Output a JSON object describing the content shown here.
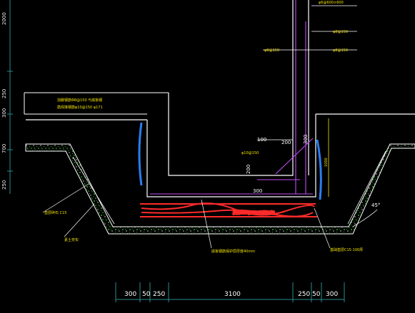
{
  "drawing": {
    "notes_top_left": [
      "加腋钢筋Φ8@150 与底板钢",
      "筋焊接钢筋φ10@150 φ171"
    ],
    "wall_rebar_labels": [
      "φ6@600×600",
      "φ8@150",
      "φ8@150",
      "φ8@150",
      "φ8@150"
    ],
    "haunch_dims": {
      "h": "100",
      "w": "200",
      "v": "300",
      "bottom": "300",
      "left": "200",
      "rebar": "φ10@150"
    },
    "slab_rebar_label": "底板Φ10@150(双层双向)",
    "pile_height_dim": "1000",
    "slope_angle": "45°",
    "left_leader_labels": [
      "垫层碎石 C15",
      "素土夯实"
    ],
    "bottom_leader_labels": [
      "底板钢筋保护层厚度40mm",
      "基础垫层C15-100厚"
    ],
    "dims_bottom": [
      "300",
      "50",
      "250",
      "3100",
      "250",
      "50",
      "300"
    ],
    "dims_left": [
      "2000",
      "250",
      "300",
      "700",
      "250"
    ],
    "colors": {
      "background": "#000000",
      "outline": "#ffffff",
      "rebar": "#c04cf0",
      "hatch": "#3cd23c",
      "hatch_edge": "#ffffff",
      "dim": "#2a8c8c",
      "annotation": "#f2e200",
      "highlight": "#ff2a2a",
      "blue": "#2a7ef0"
    }
  }
}
